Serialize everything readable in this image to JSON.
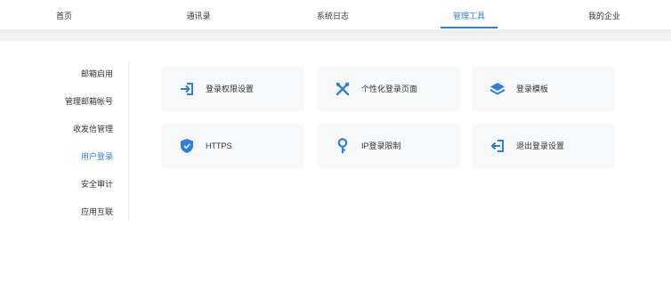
{
  "nav": {
    "items": [
      {
        "label": "首页",
        "active": false
      },
      {
        "label": "通讯录",
        "active": false
      },
      {
        "label": "系统日志",
        "active": false
      },
      {
        "label": "管理工具",
        "active": true
      },
      {
        "label": "我的企业",
        "active": false
      }
    ]
  },
  "sidebar": {
    "items": [
      {
        "label": "邮箱启用",
        "active": false
      },
      {
        "label": "管理邮箱帐号",
        "active": false
      },
      {
        "label": "收发信管理",
        "active": false
      },
      {
        "label": "用户登录",
        "active": true
      },
      {
        "label": "安全审计",
        "active": false
      },
      {
        "label": "应用互联",
        "active": false
      }
    ]
  },
  "cards": [
    {
      "label": "登录权限设置",
      "icon": "login-arrow-icon"
    },
    {
      "label": "个性化登录页面",
      "icon": "tools-icon"
    },
    {
      "label": "登录模板",
      "icon": "layers-icon"
    },
    {
      "label": "HTTPS",
      "icon": "shield-icon"
    },
    {
      "label": "IP登录限制",
      "icon": "key-icon"
    },
    {
      "label": "退出登录设置",
      "icon": "logout-arrow-icon"
    }
  ],
  "colors": {
    "accent": "#2e7de0",
    "card_bg": "#f7f8fa"
  }
}
